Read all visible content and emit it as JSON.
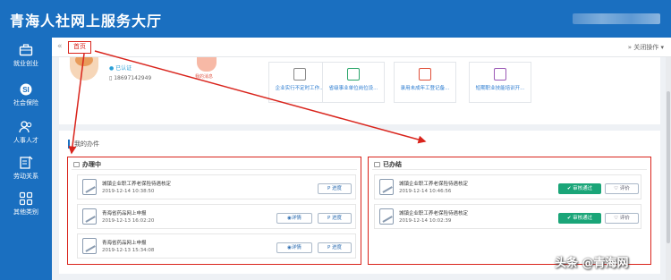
{
  "app": {
    "title": "青海人社网上服务大厅"
  },
  "sidebar": {
    "items": [
      {
        "label": "就业创业",
        "icon": "briefcase-icon"
      },
      {
        "label": "社会保险",
        "icon": "shield-icon"
      },
      {
        "label": "人事人才",
        "icon": "people-icon"
      },
      {
        "label": "劳动关系",
        "icon": "document-edit-icon"
      },
      {
        "label": "其他类别",
        "icon": "grid-icon"
      }
    ]
  },
  "tabs": {
    "prev": "«",
    "home": "首页",
    "close_ops": "» 关闭操作 ▾"
  },
  "user": {
    "status": "已认证",
    "phone": "18697142949"
  },
  "message": {
    "label": "我的消息"
  },
  "shortcuts": [
    {
      "label": "企业实行不定时工作..."
    },
    {
      "label": "省级事业单位岗位设..."
    },
    {
      "label": "录用未成年工登记备..."
    },
    {
      "label": "短期职业技能培训开..."
    }
  ],
  "my_tasks": {
    "title": "我的办件",
    "in_progress": {
      "heading": "办理中",
      "items": [
        {
          "name": "城镇企业职工养老保险待遇核定",
          "time": "2019-12-14 10:38:50",
          "buttons": [
            "进度"
          ]
        },
        {
          "name": "青海省药品网上申报",
          "time": "2019-12-13 16:02:20",
          "buttons": [
            "详情",
            "进度"
          ]
        },
        {
          "name": "青海省药品网上申报",
          "time": "2019-12-13 15:34:08",
          "buttons": [
            "详情",
            "进度"
          ]
        }
      ]
    },
    "done": {
      "heading": "已办结",
      "items": [
        {
          "name": "城镇企业职工养老保险待遇核定",
          "time": "2019-12-14 10:46:56",
          "status": "审核通过",
          "rate": "评价"
        },
        {
          "name": "城镇企业职工养老保险待遇核定",
          "time": "2019-12-14 10:02:39",
          "status": "审核通过",
          "rate": "评价"
        }
      ]
    }
  },
  "watermark": "头条 @青海网",
  "colors": {
    "primary": "#1a6fc0",
    "annotation_red": "#d9241c",
    "success": "#1aa578"
  }
}
